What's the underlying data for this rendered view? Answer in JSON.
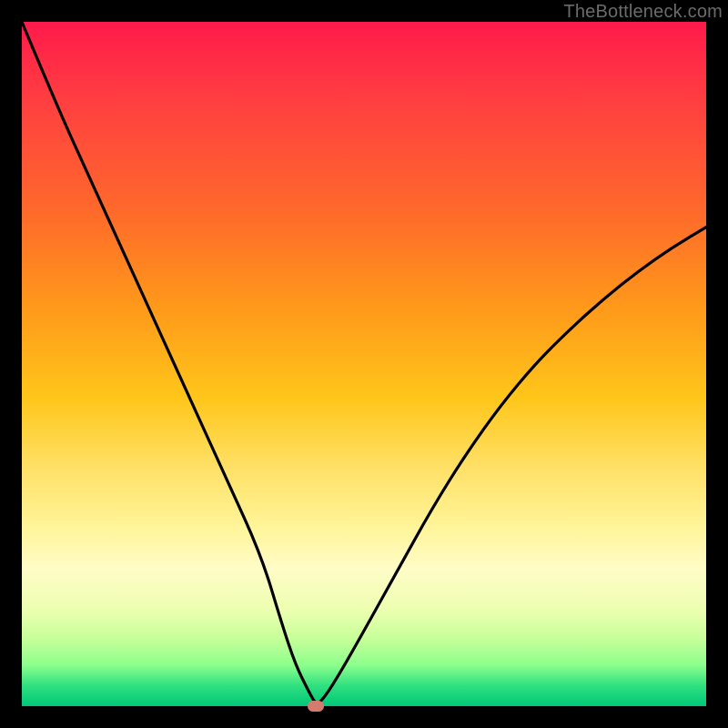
{
  "watermark": "TheBottleneck.com",
  "colors": {
    "frame_bg": "#000000",
    "gradient_top": "#ff1a4b",
    "gradient_bottom": "#00c878",
    "curve_stroke": "#000000",
    "dot_fill": "#d47a6f",
    "watermark_text": "#6b6b6b"
  },
  "chart_data": {
    "type": "line",
    "title": "",
    "xlabel": "",
    "ylabel": "",
    "xlim": [
      0,
      100
    ],
    "ylim": [
      0,
      100
    ],
    "x": [
      0,
      5,
      10,
      15,
      20,
      25,
      30,
      35,
      38,
      40,
      42,
      43,
      44,
      46,
      50,
      55,
      60,
      65,
      70,
      75,
      80,
      85,
      90,
      95,
      100
    ],
    "values": [
      100,
      88,
      77,
      66,
      55,
      44,
      33,
      22,
      12,
      6,
      2,
      0.2,
      1,
      4,
      11,
      20,
      29,
      37,
      44,
      50,
      55,
      59.5,
      63.5,
      67,
      70
    ],
    "minimum": {
      "x": 43,
      "y": 0
    },
    "background_gradient": "vertical red-yellow-green",
    "note": "values estimated from pixel positions; axes unlabeled in source image"
  },
  "plot_geometry": {
    "inner_left": 24,
    "inner_top": 24,
    "inner_size": 752
  }
}
